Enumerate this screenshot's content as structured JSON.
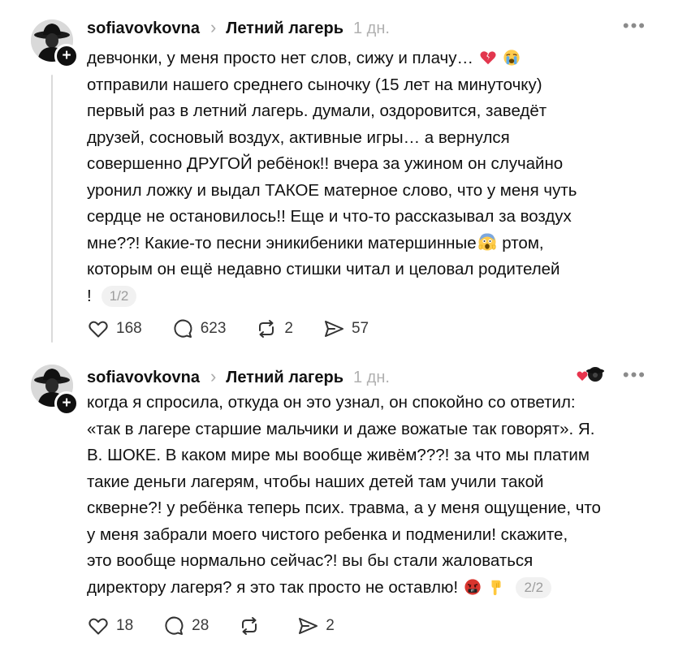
{
  "posts": [
    {
      "username": "sofiavovkovna",
      "topic": "Летний лагерь",
      "time": "1 дн.",
      "text_lines": [
        "девчонки, у меня просто нет слов, сижу и плачу…",
        "отправили нашего среднего сыночку (15 лет на минуточку)",
        "первый раз в летний лагерь. думали, оздоровится, заведёт",
        "друзей, сосновый воздух, активные игры… а вернулся",
        "совершенно ДРУГОЙ ребёнок!! вчера за ужином он случайно",
        "уронил ложку и выдал ТАКОЕ матерное слово, что у меня чуть",
        "сердце не остановилось!! Еще и что-то рассказывал за воздух",
        "мне??! Какие-то песни эникибеники матершинные",
        " ртом,",
        "которым он ещё недавно стишки читал и целовал родителей",
        "!"
      ],
      "page_indicator": "1/2",
      "likes": "168",
      "comments": "623",
      "reposts": "2",
      "shares": "57"
    },
    {
      "username": "sofiavovkovna",
      "topic": "Летний лагерь",
      "time": "1 дн.",
      "text_lines": [
        "когда я спросила, откуда он это узнал, он спокойно со ответил:",
        "«так в лагере старшие мальчики и даже вожатые так говорят». Я.",
        "В. ШОКЕ. В каком мире мы вообще живём???! за что мы платим",
        "такие деньги лагерям, чтобы наших детей там учили такой",
        "скверне?! у ребёнка теперь псих. травма, а у меня ощущение, что",
        "у меня забрали моего чистого ребенка и подменили! скажите,",
        "это вообще нормально сейчас?! вы бы стали жаловаться",
        "директору лагеря? я это так просто не оставлю!"
      ],
      "page_indicator": "2/2",
      "likes": "18",
      "comments": "28",
      "shares": "2"
    }
  ],
  "icons": {
    "like": "heart-icon",
    "comment": "comment-bubble-icon",
    "repost": "repost-icon",
    "share": "share-plane-icon",
    "more": "more-dots-icon",
    "follow": "plus-icon"
  },
  "colors": {
    "text": "#101010",
    "muted": "#b0b0b0",
    "thread_line": "#dadada",
    "badge_bg": "#f1f1f1",
    "reaction_heart": "#e8344e"
  }
}
